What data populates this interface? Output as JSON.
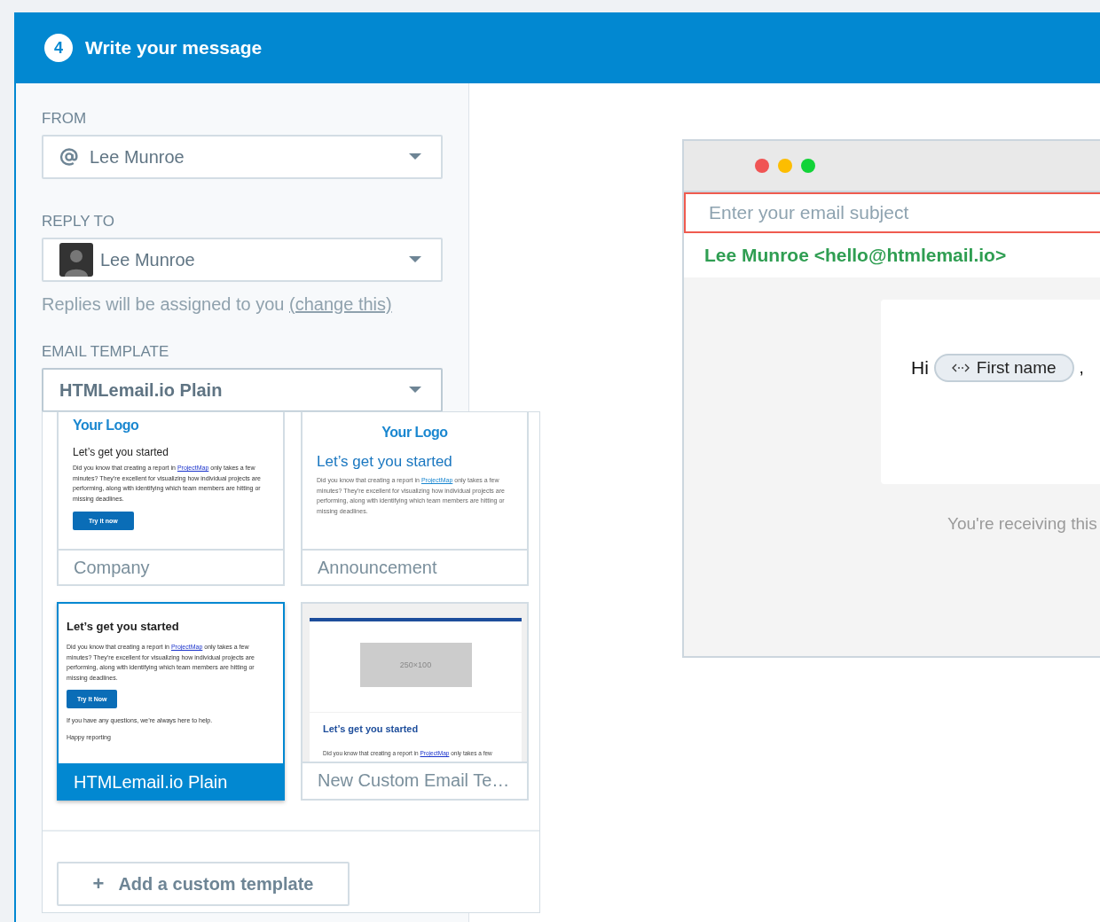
{
  "header": {
    "step": "4",
    "title": "Write your message"
  },
  "from": {
    "label": "FROM",
    "value": "Lee Munroe"
  },
  "reply_to": {
    "label": "REPLY TO",
    "value": "Lee Munroe",
    "note": "Replies will be assigned to you",
    "link": "(change this)"
  },
  "email_template": {
    "label": "EMAIL TEMPLATE",
    "value": "HTMLemail.io Plain",
    "expanded": true
  },
  "templates": [
    {
      "kind": "company",
      "name": "Company",
      "selected": false,
      "logo": "Your Logo",
      "heading": "Let’s get you started",
      "body_start": "Did you know that creating a report in ",
      "body_link": "ProjectMap",
      "body_end": " only takes a few minutes? They’re excellent for visualizing how individual projects are performing, along with identifying which team members are hitting or missing deadlines.",
      "button": "Try it now"
    },
    {
      "kind": "announcement",
      "name": "Announcement",
      "selected": false,
      "logo": "Your Logo",
      "heading": "Let’s get you started",
      "body_start": "Did you know that creating a report in ",
      "body_link": "ProjectMap",
      "body_end": " only takes a few minutes? They’re excellent for visualizing how individual projects are performing, along with identifying which team members are hitting or missing deadlines."
    },
    {
      "kind": "plain",
      "name": "HTMLemail.io Plain",
      "selected": true,
      "heading": "Let’s get you started",
      "body_start": "Did you know that creating a report in ",
      "body_link": "ProjectMap",
      "body_end": " only takes a few minutes? They’re excellent for visualizing how individual projects are performing, along with identifying which team members are hitting or missing deadlines.",
      "button": "Try It Now",
      "extra": [
        "If you have any questions, we’re always here to help.",
        "Happy reporting"
      ]
    },
    {
      "kind": "custom",
      "name": "New Custom Email Te…",
      "selected": false,
      "image": "250×100",
      "heading": "Let’s get you started",
      "body_start": "Did you know that creating a report in ",
      "body_link": "ProjectMap",
      "body_end": " only takes a few"
    }
  ],
  "add_template": {
    "icon": "+",
    "label": "Add a custom template"
  },
  "preview": {
    "subject_placeholder": "Enter your email subject",
    "subject_invalid": true,
    "from": "Lee Munroe <hello@htmlemail.io>",
    "greeting": "Hi",
    "merge_tag": "First name",
    "after_tag": ",",
    "footer": "You're receiving this"
  }
}
